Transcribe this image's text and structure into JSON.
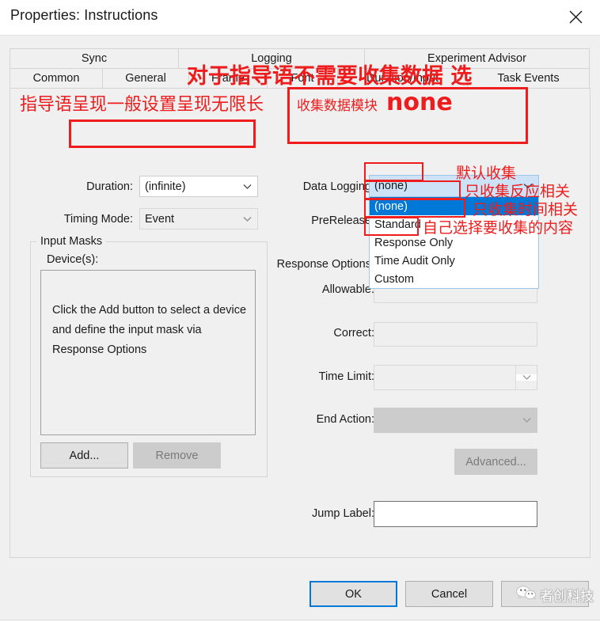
{
  "window": {
    "title": "Properties: Instructions",
    "close_icon": "close-icon"
  },
  "tabs": {
    "row1": [
      {
        "label": "Sync",
        "selected": false
      },
      {
        "label": "Logging",
        "selected": false
      },
      {
        "label": "Experiment Advisor",
        "selected": false
      }
    ],
    "row2": [
      {
        "label": "Common",
        "selected": false
      },
      {
        "label": "General",
        "selected": false
      },
      {
        "label": "Frame",
        "selected": false
      },
      {
        "label": "Font",
        "selected": false
      },
      {
        "label": "Duration/Input",
        "selected": true
      },
      {
        "label": "Task Events",
        "selected": false
      }
    ]
  },
  "form": {
    "duration_label": "Duration:",
    "duration_value": "(infinite)",
    "timing_mode_label": "Timing Mode:",
    "timing_mode_value": "Event",
    "data_logging_label": "Data Logging:",
    "data_logging_value": "(none)",
    "prerelease_label": "PreRelease:",
    "response_options_label": "Response Options:",
    "allowable_label": "Allowable:",
    "allowable_value": "",
    "correct_label": "Correct:",
    "correct_value": "",
    "time_limit_label": "Time Limit:",
    "time_limit_value": "",
    "end_action_label": "End Action:",
    "end_action_value": "",
    "jump_label_label": "Jump Label:",
    "jump_label_value": "",
    "advanced_button": "Advanced..."
  },
  "input_masks": {
    "group_title": "Input Masks",
    "devices_label": "Device(s):",
    "listbox_hint": "Click the Add button to select a device and define the input mask via Response Options",
    "add_button": "Add...",
    "remove_button": "Remove"
  },
  "data_logging_dropdown": {
    "open": true,
    "items": [
      {
        "label": "(none)",
        "selected": true
      },
      {
        "label": "Standard",
        "selected": false
      },
      {
        "label": "Response Only",
        "selected": false
      },
      {
        "label": "Time Audit Only",
        "selected": false
      },
      {
        "label": "Custom",
        "selected": false
      }
    ]
  },
  "footer": {
    "ok_button": "OK",
    "cancel_button": "Cancel",
    "apply_button": ""
  },
  "annotations": {
    "color": "#ee1c1c",
    "top_note": "对于指导语不需要收集数据   选",
    "left_note": "指导语呈现一般设置呈现无限长",
    "module_note": "收集数据模块",
    "module_value": "none",
    "standard_note": "默认收集",
    "response_only_note": "只收集反应相关",
    "time_audit_note": "只收集时间相关",
    "custom_note": "自己选择要收集的内容"
  },
  "watermark": {
    "text": "者创科技",
    "icon": "wechat-icon"
  }
}
